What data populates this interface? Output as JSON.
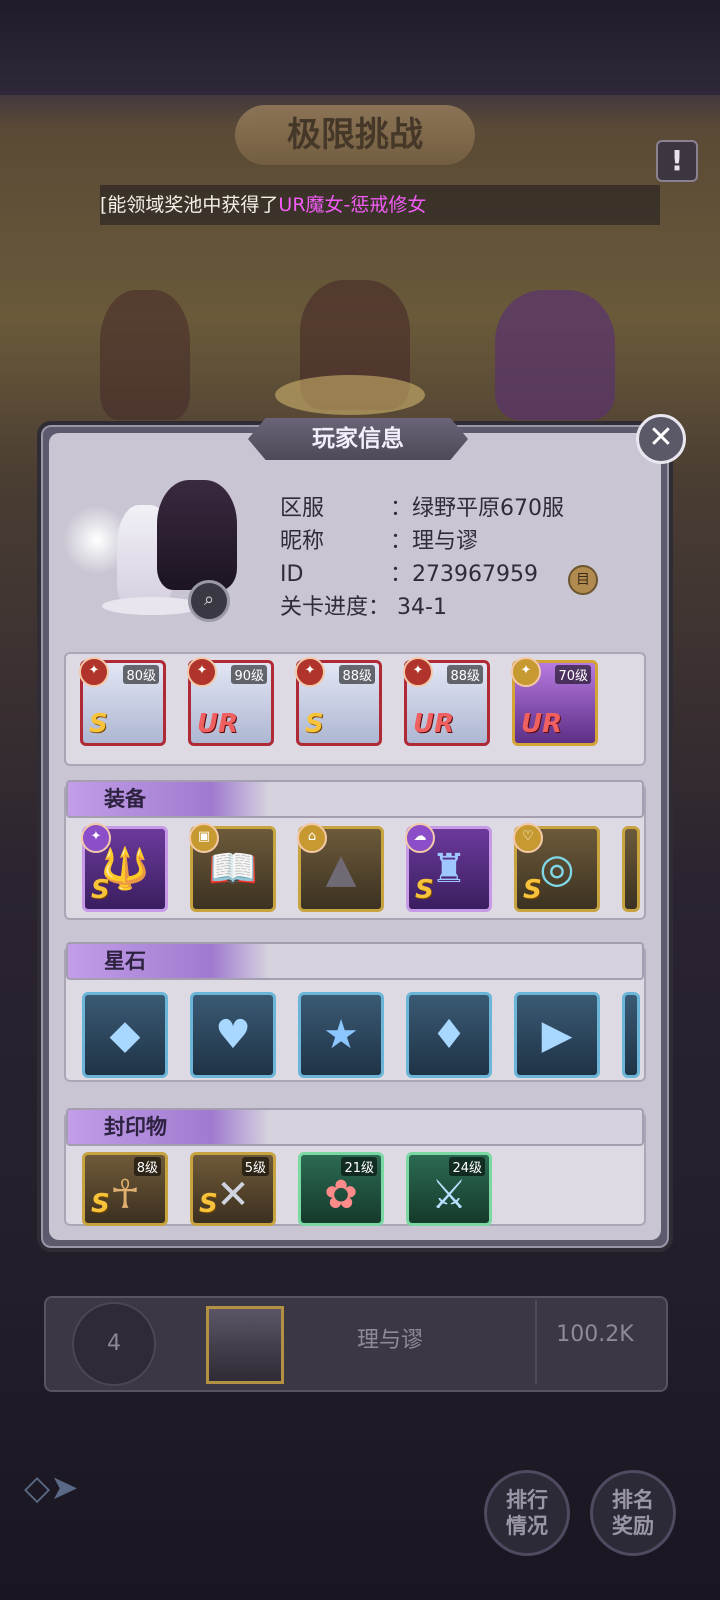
{
  "background": {
    "title": "极限挑战",
    "ticker": {
      "white": "[能领域奖池中获得了",
      "magenta": "UR魔女-惩戒修女"
    }
  },
  "dialog": {
    "title": "玩家信息",
    "info": {
      "server_label": "区服",
      "server_value": "：绿野平原670服",
      "nick_label": "昵称",
      "nick_value": "：理与谬",
      "id_label": "ID",
      "id_value": "：273967959",
      "progress_label": "关卡进度：",
      "progress_value": "34-1"
    },
    "heroes": [
      {
        "level": "80级",
        "rank": "S"
      },
      {
        "level": "90级",
        "rank": "UR"
      },
      {
        "level": "88级",
        "rank": "S"
      },
      {
        "level": "88级",
        "rank": "UR"
      },
      {
        "level": "70级",
        "rank": "UR"
      }
    ],
    "sections": {
      "equipment": "装备",
      "stones": "星石",
      "seals": "封印物"
    },
    "equipment": [
      {
        "rank": "S",
        "icon": "trident-icon"
      },
      {
        "rank": "",
        "icon": "book-icon"
      },
      {
        "rank": "",
        "icon": "hat-icon"
      },
      {
        "rank": "S",
        "icon": "cloak-icon"
      },
      {
        "rank": "S",
        "icon": "ring-icon"
      }
    ],
    "stones": [
      "square-gem-icon",
      "heart-gem-icon",
      "star-gem-icon",
      "diamond-gem-icon",
      "drop-gem-icon"
    ],
    "seals": [
      {
        "level": "8级",
        "rank": "S"
      },
      {
        "level": "5级",
        "rank": "S"
      },
      {
        "level": "21级",
        "rank": ""
      },
      {
        "level": "24级",
        "rank": ""
      }
    ]
  },
  "ranking": {
    "rank": "4",
    "name": "理与谬",
    "score": "100.2K"
  },
  "buttons": {
    "rank_status": "排行情况",
    "rank_reward": "排名奖励"
  }
}
